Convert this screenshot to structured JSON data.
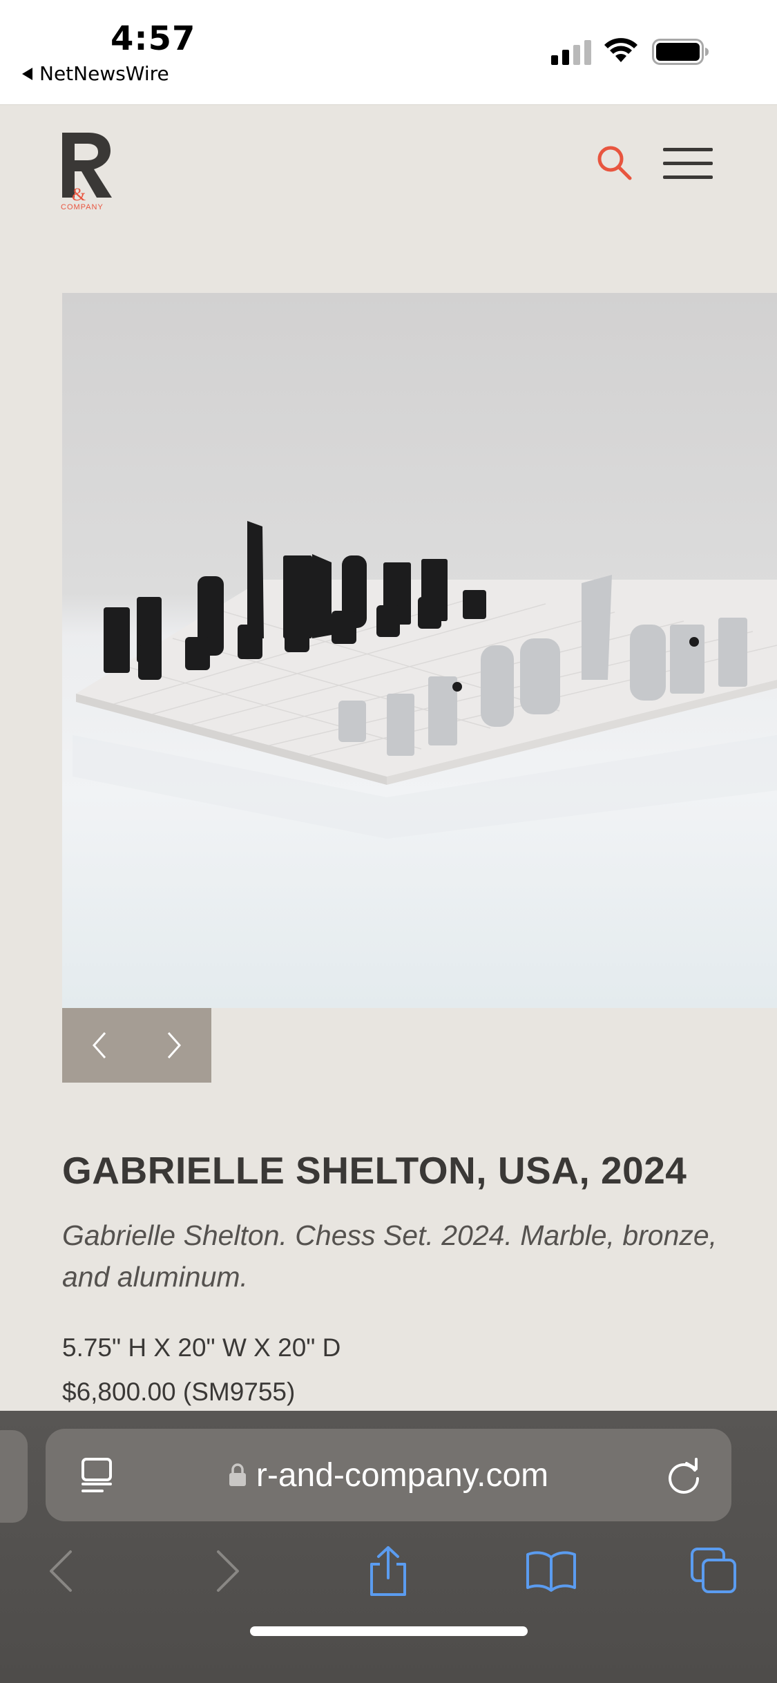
{
  "status_bar": {
    "time": "4:57",
    "back_app": "NetNewsWire",
    "signal_icon": "cellular-signal-icon",
    "wifi_icon": "wifi-icon",
    "battery_icon": "battery-icon"
  },
  "header": {
    "logo_letter": "R",
    "logo_ampersand": "&",
    "logo_company": "COMPANY",
    "accent_color": "#e8553f",
    "search_icon": "search-icon",
    "menu_icon": "hamburger-menu-icon"
  },
  "product": {
    "image_alt": "Chess set with black and aluminum pieces on white marble board",
    "prev_icon": "chevron-left-icon",
    "next_icon": "chevron-right-icon",
    "title": "GABRIELLE SHELTON, USA, 2024",
    "caption": "Gabrielle Shelton. Chess Set. 2024. Marble, bronze, and aluminum.",
    "dimensions": "5.75\" H X 20\" W X 20\" D",
    "price": "$6,800.00 (SM9755)"
  },
  "browser": {
    "url": "r-and-company.com",
    "reader_icon": "reader-mode-icon",
    "lock_icon": "lock-icon",
    "reload_icon": "reload-icon",
    "toolbar": [
      "back-icon",
      "forward-icon",
      "share-icon",
      "bookmarks-icon",
      "tabs-icon"
    ],
    "icon_color": "#5b9cf0"
  }
}
